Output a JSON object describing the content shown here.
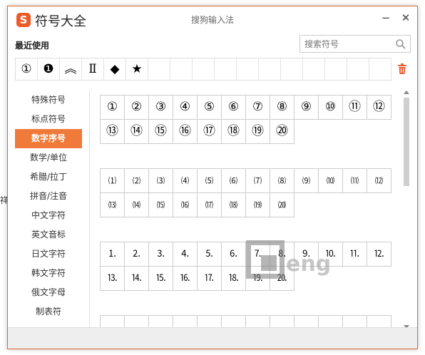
{
  "background_edge_char": "祥",
  "window": {
    "app_name": "符号大全",
    "ime_name": "搜狗输入法",
    "logo_letter": "S",
    "minimize_glyph": "−",
    "close_glyph": "✕",
    "accent_color": "#f07a3a"
  },
  "recent": {
    "label": "最近使用",
    "items": [
      "①",
      "❶",
      "︽",
      "Ⅱ",
      "◆",
      "★",
      "",
      "",
      "",
      "",
      "",
      "",
      "",
      "",
      "",
      "",
      ""
    ],
    "trash_icon": "trash-icon"
  },
  "search": {
    "placeholder": "搜索符号",
    "icon": "search-icon"
  },
  "sidebar": {
    "items": [
      {
        "label": "特殊符号",
        "active": false
      },
      {
        "label": "标点符号",
        "active": false
      },
      {
        "label": "数字序号",
        "active": true
      },
      {
        "label": "数学/单位",
        "active": false
      },
      {
        "label": "希腊/拉丁",
        "active": false
      },
      {
        "label": "拼音/注音",
        "active": false
      },
      {
        "label": "中文字符",
        "active": false
      },
      {
        "label": "英文音标",
        "active": false
      },
      {
        "label": "日文字符",
        "active": false
      },
      {
        "label": "韩文字符",
        "active": false
      },
      {
        "label": "俄文字母",
        "active": false
      },
      {
        "label": "制表符",
        "active": false
      }
    ]
  },
  "symbol_groups": [
    {
      "symbols": [
        "①",
        "②",
        "③",
        "④",
        "⑤",
        "⑥",
        "⑦",
        "⑧",
        "⑨",
        "⑩",
        "⑪",
        "⑫",
        "⑬",
        "⑭",
        "⑮",
        "⑯",
        "⑰",
        "⑱",
        "⑲",
        "⑳"
      ]
    },
    {
      "symbols": [
        "⑴",
        "⑵",
        "⑶",
        "⑷",
        "⑸",
        "⑹",
        "⑺",
        "⑻",
        "⑼",
        "⑽",
        "⑾",
        "⑿",
        "⒀",
        "⒁",
        "⒂",
        "⒃",
        "⒄",
        "⒅",
        "⒆",
        "⒇"
      ]
    },
    {
      "symbols": [
        "⒈",
        "⒉",
        "⒊",
        "⒋",
        "⒌",
        "⒍",
        "⒎",
        "⒏",
        "⒐",
        "⒑",
        "⒒",
        "⒓",
        "⒔",
        "⒕",
        "⒖",
        "⒗",
        "⒘",
        "⒙",
        "⒚",
        "⒛"
      ]
    }
  ],
  "watermark": {
    "text": "eng"
  }
}
